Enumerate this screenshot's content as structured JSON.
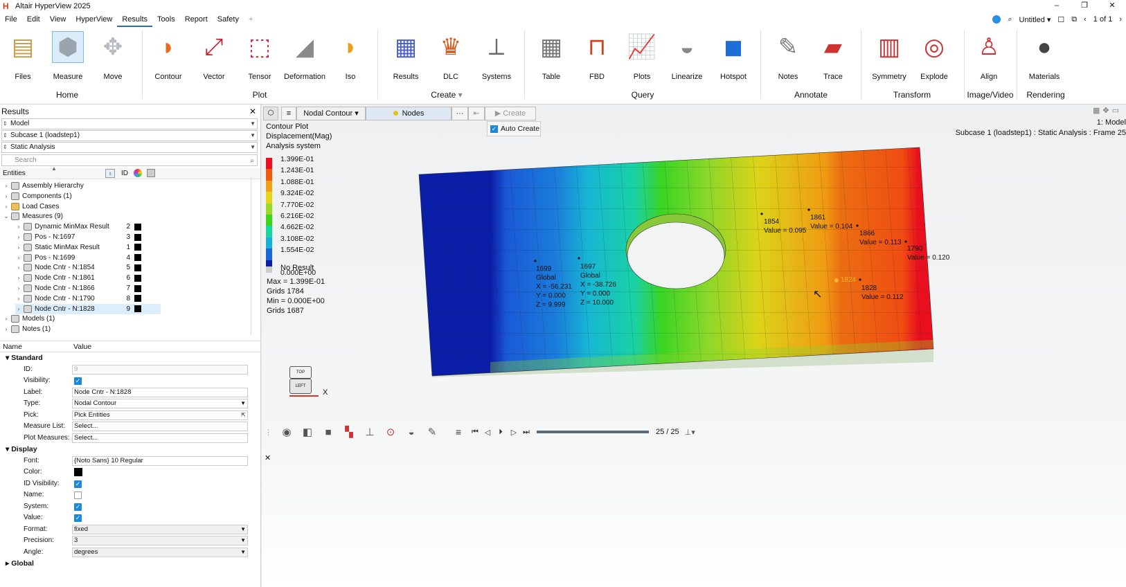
{
  "app": {
    "title": "Altair HyperView 2025",
    "logo_letter": "H"
  },
  "window_controls": [
    "–",
    "❐",
    "✕"
  ],
  "menu": {
    "items": [
      "File",
      "Edit",
      "View",
      "HyperView",
      "Results",
      "Tools",
      "Report",
      "Safety"
    ],
    "active": "Results",
    "add_tab": "+",
    "session": "Untitled",
    "page_indicator": "1 of 1"
  },
  "ribbon": {
    "tools": [
      {
        "label": "Files",
        "icon": "files-icon"
      },
      {
        "label": "Measure",
        "icon": "measure-icon"
      },
      {
        "label": "Move",
        "icon": "move-icon"
      },
      {
        "label": "Contour",
        "icon": "contour-icon"
      },
      {
        "label": "Vector",
        "icon": "vector-icon"
      },
      {
        "label": "Tensor",
        "icon": "tensor-icon"
      },
      {
        "label": "Deformation",
        "icon": "deformation-icon"
      },
      {
        "label": "Iso",
        "icon": "iso-icon"
      },
      {
        "label": "Results",
        "icon": "results-icon"
      },
      {
        "label": "DLC",
        "icon": "dlc-icon"
      },
      {
        "label": "Systems",
        "icon": "systems-icon"
      },
      {
        "label": "Table",
        "icon": "table-icon"
      },
      {
        "label": "FBD",
        "icon": "fbd-icon"
      },
      {
        "label": "Plots",
        "icon": "plots-icon"
      },
      {
        "label": "Linearize",
        "icon": "linearize-icon"
      },
      {
        "label": "Hotspot",
        "icon": "hotspot-icon"
      },
      {
        "label": "Notes",
        "icon": "notes-icon"
      },
      {
        "label": "Trace",
        "icon": "trace-icon"
      },
      {
        "label": "Symmetry",
        "icon": "symmetry-icon"
      },
      {
        "label": "Explode",
        "icon": "explode-icon"
      },
      {
        "label": "Align",
        "icon": "align-icon"
      },
      {
        "label": "Materials",
        "icon": "materials-icon"
      }
    ],
    "groups": [
      "Home",
      "Plot",
      "Create",
      "Query",
      "Annotate",
      "Transform",
      "Image/Video",
      "Rendering"
    ]
  },
  "results_panel": {
    "title": "Results",
    "close": "✕",
    "model": "Model",
    "subcase": "Subcase 1 (loadstep1)",
    "analysis": "Static Analysis",
    "search_placeholder": "Search",
    "entities_header": "Entities",
    "id_header": "ID",
    "tree": [
      {
        "label": "Assembly Hierarchy",
        "level": 0,
        "toggle": "›"
      },
      {
        "label": "Components (1)",
        "level": 0,
        "toggle": "›"
      },
      {
        "label": "Load Cases",
        "level": 0,
        "toggle": "›"
      },
      {
        "label": "Measures (9)",
        "level": 0,
        "toggle": "⌄"
      },
      {
        "label": "Dynamic MinMax Result",
        "level": 1,
        "toggle": "›",
        "id": "2"
      },
      {
        "label": "Pos - N:1697",
        "level": 1,
        "toggle": "›",
        "id": "3"
      },
      {
        "label": "Static MinMax Result",
        "level": 1,
        "toggle": "›",
        "id": "1"
      },
      {
        "label": "Pos - N:1699",
        "level": 1,
        "toggle": "›",
        "id": "4"
      },
      {
        "label": "Node Cntr - N:1854",
        "level": 1,
        "toggle": "›",
        "id": "5"
      },
      {
        "label": "Node Cntr - N:1861",
        "level": 1,
        "toggle": "›",
        "id": "6"
      },
      {
        "label": "Node Cntr - N:1866",
        "level": 1,
        "toggle": "›",
        "id": "7"
      },
      {
        "label": "Node Cntr - N:1790",
        "level": 1,
        "toggle": "›",
        "id": "8"
      },
      {
        "label": "Node Cntr - N:1828",
        "level": 1,
        "toggle": "›",
        "id": "9",
        "selected": true
      },
      {
        "label": "Models (1)",
        "level": 0,
        "toggle": "›"
      },
      {
        "label": "Notes (1)",
        "level": 0,
        "toggle": "›"
      }
    ]
  },
  "properties": {
    "name_header": "Name",
    "value_header": "Value",
    "standard": {
      "title": "Standard",
      "id_label": "ID:",
      "id_value": "9",
      "visibility_label": "Visibility:",
      "label_label": "Label:",
      "label_value": "Node Cntr - N:1828",
      "type_label": "Type:",
      "type_value": "Nodal Contour",
      "pick_label": "Pick:",
      "pick_value": "Pick Entities",
      "measure_list_label": "Measure List:",
      "measure_list_value": "Select...",
      "plot_measures_label": "Plot Measures:",
      "plot_measures_value": "Select..."
    },
    "display": {
      "title": "Display",
      "font_label": "Font:",
      "font_value": "{Noto Sans} 10 Regular",
      "color_label": "Color:",
      "id_visibility_label": "ID Visibility:",
      "name_label": "Name:",
      "system_label": "System:",
      "value_label": "Value:",
      "format_label": "Format:",
      "format_value": "fixed",
      "precision_label": "Precision:",
      "precision_value": "3",
      "angle_label": "Angle:",
      "angle_value": "degrees"
    },
    "global_title": "Global"
  },
  "viewport_toolbar": {
    "contour_type": "Nodal Contour",
    "entity": "Nodes",
    "more": "···",
    "create": "Create",
    "auto_create": "Auto Create"
  },
  "contour_legend": {
    "title_lines": [
      "Contour Plot",
      "Displacement(Mag)",
      "Analysis system"
    ],
    "values": [
      "1.399E-01",
      "1.243E-01",
      "1.088E-01",
      "9.324E-02",
      "7.770E-02",
      "6.216E-02",
      "4.662E-02",
      "3.108E-02",
      "1.554E-02",
      "0.000E+00"
    ],
    "colors": [
      "#e8101e",
      "#ef5a10",
      "#f3a114",
      "#e8d416",
      "#9ad828",
      "#3ed31c",
      "#19d5a0",
      "#17b2d6",
      "#1a66d8",
      "#0a1ea6"
    ],
    "no_result": "No Result",
    "stats": [
      "Max = 1.399E-01",
      "Grids 1784",
      "Min = 0.000E+00",
      "Grids 1687"
    ]
  },
  "viewport_header": {
    "model": "1: Model",
    "subcase_line": "Subcase 1 (loadstep1) : Static Analysis : Frame 25"
  },
  "annotations": [
    {
      "lines": [
        "1699",
        "Global",
        "X = -56.231",
        "Y = 0.000",
        "Z = 9.999"
      ]
    },
    {
      "lines": [
        "1697",
        "Global",
        "X = -38.726",
        "Y = 0.000",
        "Z = 10.000"
      ]
    },
    {
      "lines": [
        "1854",
        "Value = 0.095"
      ]
    },
    {
      "lines": [
        "1861",
        "Value = 0.104"
      ]
    },
    {
      "lines": [
        "1866",
        "Value = 0.113"
      ]
    },
    {
      "lines": [
        "1790",
        "Value = 0.120"
      ]
    },
    {
      "lines": [
        "1828",
        "Value = 0.112"
      ]
    },
    {
      "lines": [
        "1824"
      ]
    }
  ],
  "view_cube": {
    "top": "TOP",
    "left": "LEFT",
    "axis": "X"
  },
  "animation": {
    "frame": "25 / 25",
    "progress_fraction": 1.0
  },
  "viewport_close": "✕"
}
